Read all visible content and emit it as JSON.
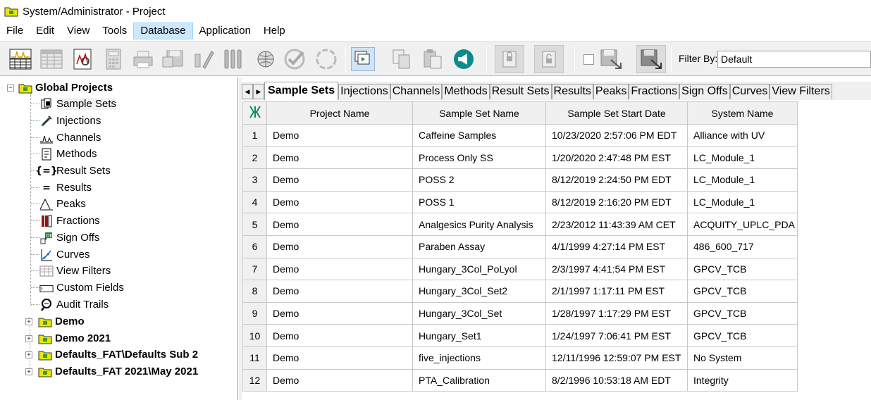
{
  "window": {
    "title": "System/Administrator - Project"
  },
  "menu": [
    "File",
    "Edit",
    "View",
    "Tools",
    "Database",
    "Application",
    "Help"
  ],
  "menu_active": "Database",
  "toolbar": {
    "filter_label": "Filter By:",
    "filter_value": "Default"
  },
  "tree": {
    "root": "Global Projects",
    "children": [
      "Sample Sets",
      "Injections",
      "Channels",
      "Methods",
      "Result Sets",
      "Results",
      "Peaks",
      "Fractions",
      "Sign Offs",
      "Curves",
      "View Filters",
      "Custom Fields",
      "Audit Trails"
    ],
    "projects": [
      "Demo",
      "Demo 2021",
      "Defaults_FAT\\Defaults Sub 2",
      "Defaults_FAT 2021\\May 2021"
    ]
  },
  "tabs": [
    "Sample Sets",
    "Injections",
    "Channels",
    "Methods",
    "Result Sets",
    "Results",
    "Peaks",
    "Fractions",
    "Sign Offs",
    "Curves",
    "View Filters"
  ],
  "tab_active": "Sample Sets",
  "grid": {
    "columns": [
      "Project Name",
      "Sample Set Name",
      "Sample Set Start Date",
      "System Name"
    ],
    "rows": [
      [
        "1",
        "Demo",
        "Caffeine Samples",
        "10/23/2020 2:57:06 PM EDT",
        "Alliance with UV"
      ],
      [
        "2",
        "Demo",
        "Process Only SS",
        "1/20/2020 2:47:48 PM EST",
        "LC_Module_1"
      ],
      [
        "3",
        "Demo",
        "POSS 2",
        "8/12/2019 2:24:50 PM EDT",
        "LC_Module_1"
      ],
      [
        "4",
        "Demo",
        "POSS 1",
        "8/12/2019 2:16:20 PM EDT",
        "LC_Module_1"
      ],
      [
        "5",
        "Demo",
        "Analgesics Purity Analysis",
        "2/23/2012 11:43:39 AM CET",
        "ACQUITY_UPLC_PDA"
      ],
      [
        "6",
        "Demo",
        "Paraben Assay",
        "4/1/1999 4:27:14 PM EST",
        "486_600_717"
      ],
      [
        "7",
        "Demo",
        "Hungary_3Col_PoLyol",
        "2/3/1997 4:41:54 PM EST",
        "GPCV_TCB"
      ],
      [
        "8",
        "Demo",
        "Hungary_3Col_Set2",
        "2/1/1997 1:17:11 PM EST",
        "GPCV_TCB"
      ],
      [
        "9",
        "Demo",
        "Hungary_3Col_Set",
        "1/28/1997 1:17:29 PM EST",
        "GPCV_TCB"
      ],
      [
        "10",
        "Demo",
        "Hungary_Set1",
        "1/24/1997 7:06:41 PM EST",
        "GPCV_TCB"
      ],
      [
        "11",
        "Demo",
        "five_injections",
        "12/11/1996 12:59:07 PM EST",
        "No System"
      ],
      [
        "12",
        "Demo",
        "PTA_Calibration",
        "8/2/1996 10:53:18 AM EDT",
        "Integrity"
      ]
    ]
  }
}
